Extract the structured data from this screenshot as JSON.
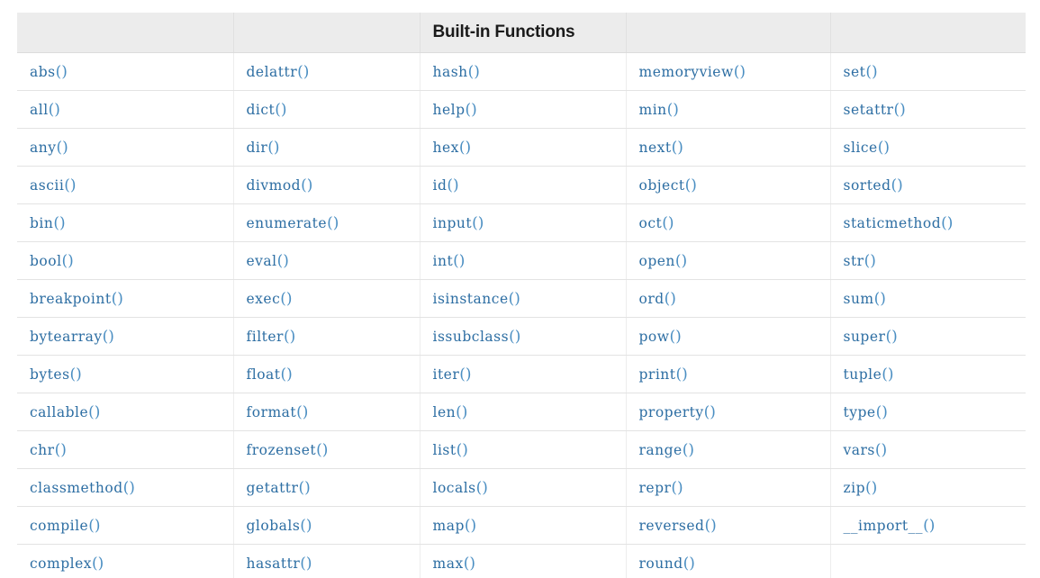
{
  "table": {
    "title": "Built-in Functions",
    "title_column_index": 2,
    "column_count": 5,
    "headers": [
      "",
      "",
      "Built-in Functions",
      "",
      ""
    ],
    "rows": [
      [
        "abs()",
        "delattr()",
        "hash()",
        "memoryview()",
        "set()"
      ],
      [
        "all()",
        "dict()",
        "help()",
        "min()",
        "setattr()"
      ],
      [
        "any()",
        "dir()",
        "hex()",
        "next()",
        "slice()"
      ],
      [
        "ascii()",
        "divmod()",
        "id()",
        "object()",
        "sorted()"
      ],
      [
        "bin()",
        "enumerate()",
        "input()",
        "oct()",
        "staticmethod()"
      ],
      [
        "bool()",
        "eval()",
        "int()",
        "open()",
        "str()"
      ],
      [
        "breakpoint()",
        "exec()",
        "isinstance()",
        "ord()",
        "sum()"
      ],
      [
        "bytearray()",
        "filter()",
        "issubclass()",
        "pow()",
        "super()"
      ],
      [
        "bytes()",
        "float()",
        "iter()",
        "print()",
        "tuple()"
      ],
      [
        "callable()",
        "format()",
        "len()",
        "property()",
        "type()"
      ],
      [
        "chr()",
        "frozenset()",
        "list()",
        "range()",
        "vars()"
      ],
      [
        "classmethod()",
        "getattr()",
        "locals()",
        "repr()",
        "zip()"
      ],
      [
        "compile()",
        "globals()",
        "map()",
        "reversed()",
        "__import__()"
      ],
      [
        "complex()",
        "hasattr()",
        "max()",
        "round()",
        ""
      ]
    ]
  },
  "colors": {
    "header_background": "#ececec",
    "header_text": "#1a1a1a",
    "cell_text": "#2d6ea3",
    "paren_text": "#4a8ec2",
    "row_divider": "#e3e3e3",
    "column_divider": "#ededed",
    "page_background": "#ffffff"
  }
}
